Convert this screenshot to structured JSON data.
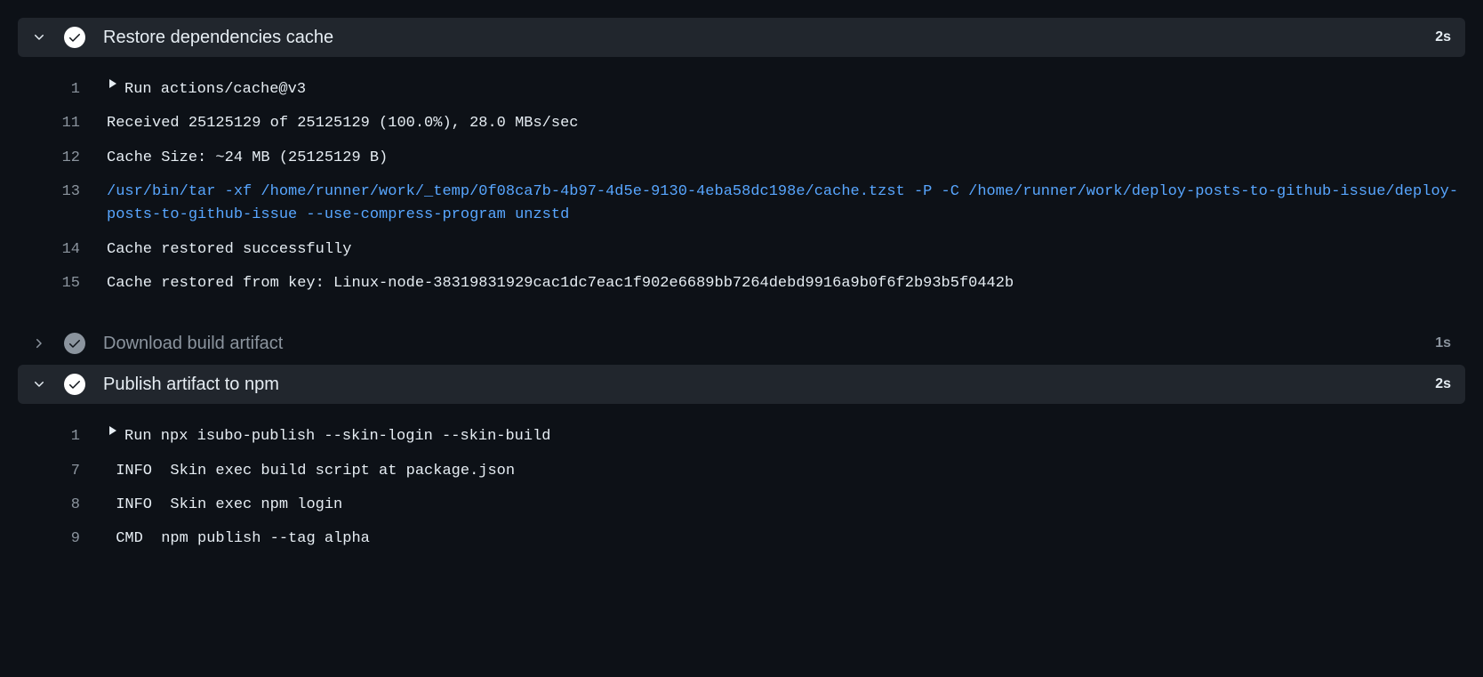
{
  "steps": [
    {
      "id": "restore-deps",
      "title": "Restore dependencies cache",
      "duration": "2s",
      "expanded": true,
      "status": "success",
      "lines": [
        {
          "no": "1",
          "group": true,
          "style": "plain",
          "text": "Run actions/cache@v3"
        },
        {
          "no": "11",
          "group": false,
          "style": "plain",
          "text": "Received 25125129 of 25125129 (100.0%), 28.0 MBs/sec"
        },
        {
          "no": "12",
          "group": false,
          "style": "plain",
          "text": "Cache Size: ~24 MB (25125129 B)"
        },
        {
          "no": "13",
          "group": false,
          "style": "blue",
          "text": "/usr/bin/tar -xf /home/runner/work/_temp/0f08ca7b-4b97-4d5e-9130-4eba58dc198e/cache.tzst -P -C /home/runner/work/deploy-posts-to-github-issue/deploy-posts-to-github-issue --use-compress-program unzstd"
        },
        {
          "no": "14",
          "group": false,
          "style": "plain",
          "text": "Cache restored successfully"
        },
        {
          "no": "15",
          "group": false,
          "style": "plain",
          "text": "Cache restored from key: Linux-node-38319831929cac1dc7eac1f902e6689bb7264debd9916a9b0f6f2b93b5f0442b"
        }
      ]
    },
    {
      "id": "download-artifact",
      "title": "Download build artifact",
      "duration": "1s",
      "expanded": false,
      "status": "neutral",
      "lines": []
    },
    {
      "id": "publish-npm",
      "title": "Publish artifact to npm",
      "duration": "2s",
      "expanded": true,
      "status": "success",
      "lines": [
        {
          "no": "1",
          "group": true,
          "style": "plain",
          "text": "Run npx isubo-publish --skin-login --skin-build"
        },
        {
          "no": "7",
          "group": false,
          "style": "plain",
          "text": " INFO  Skin exec build script at package.json"
        },
        {
          "no": "8",
          "group": false,
          "style": "plain",
          "text": " INFO  Skin exec npm login"
        },
        {
          "no": "9",
          "group": false,
          "style": "plain",
          "text": " CMD  npm publish --tag alpha"
        }
      ]
    }
  ]
}
